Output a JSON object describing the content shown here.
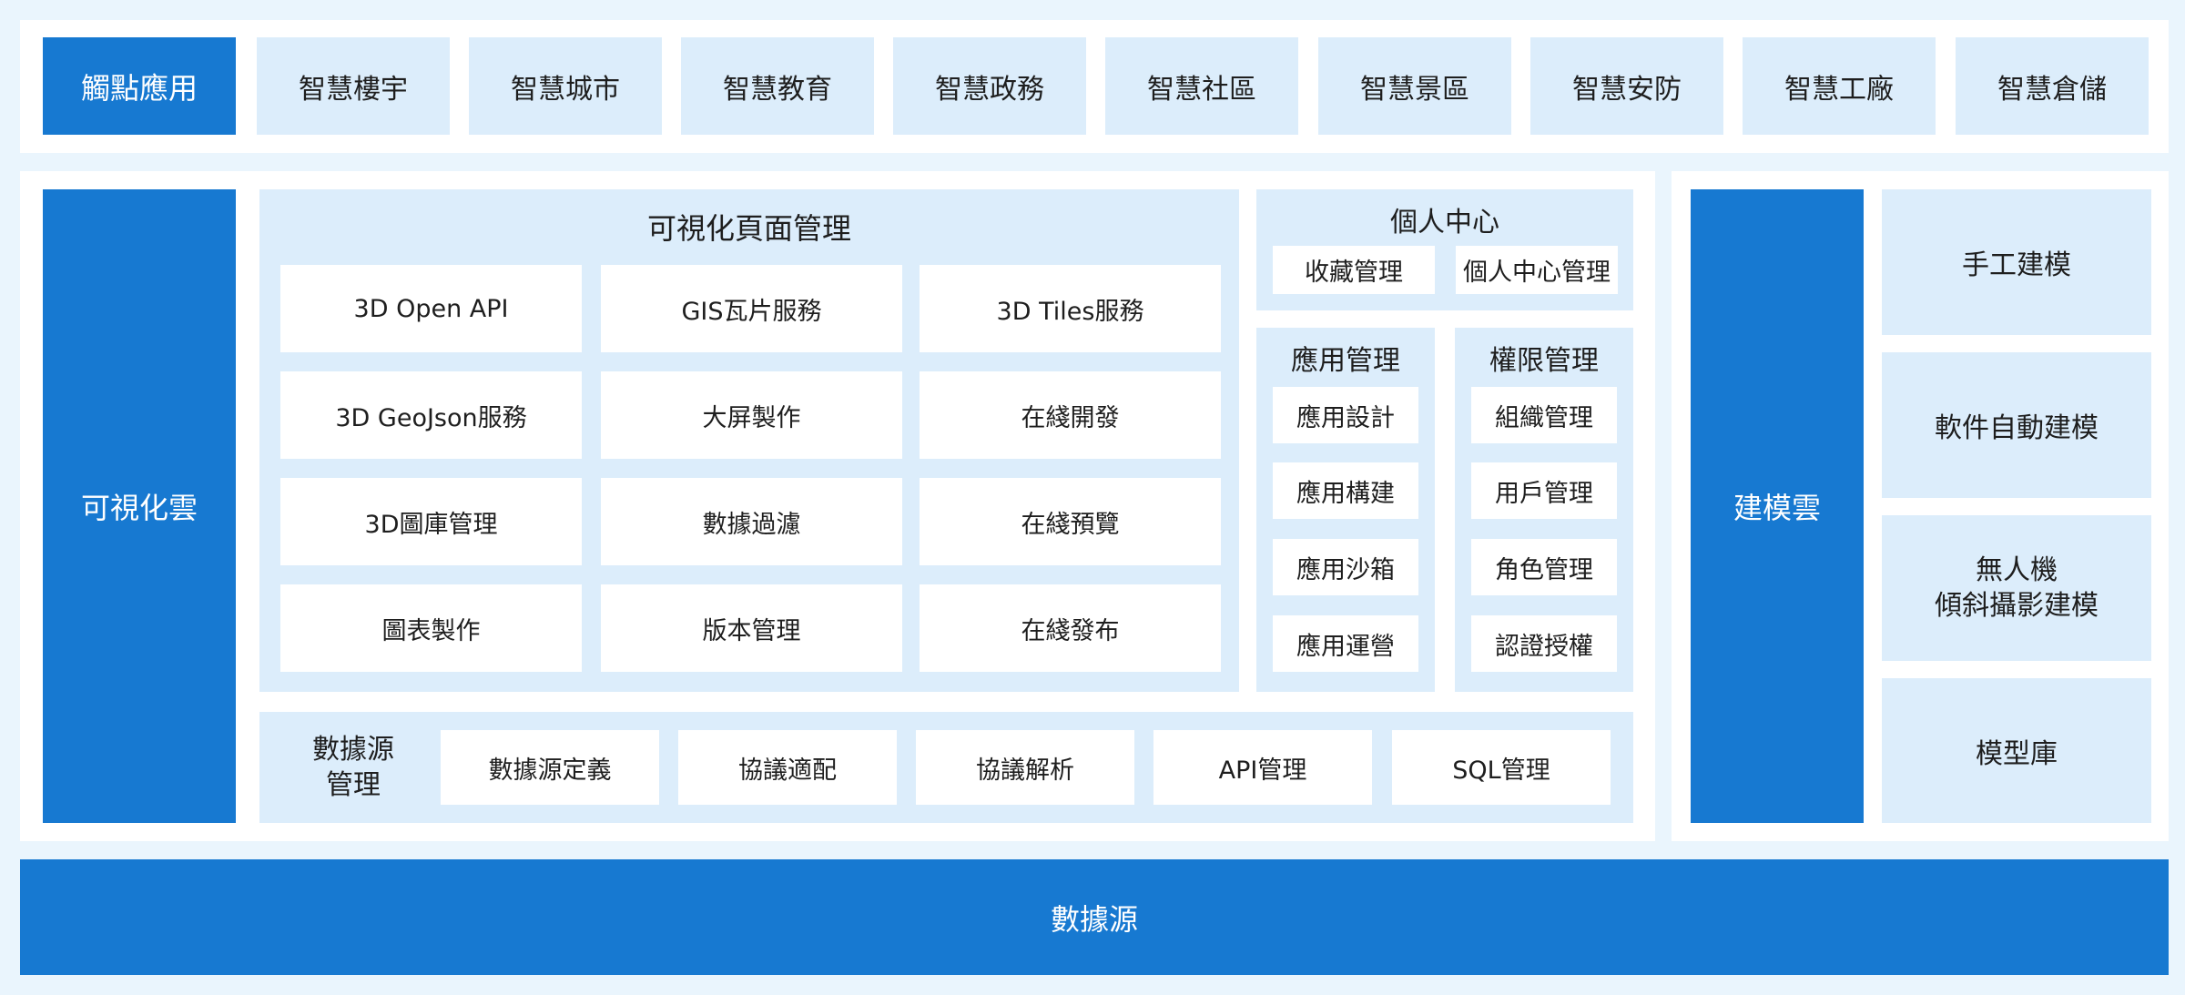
{
  "touchpoint": {
    "title": "觸點應用",
    "items": [
      "智慧樓宇",
      "智慧城市",
      "智慧教育",
      "智慧政務",
      "智慧社區",
      "智慧景區",
      "智慧安防",
      "智慧工廠",
      "智慧倉儲"
    ]
  },
  "viz_cloud": {
    "title": "可視化雲",
    "page_management": {
      "title": "可視化頁面管理",
      "items": [
        "3D Open API",
        "GIS瓦片服務",
        "3D Tiles服務",
        "3D GeoJson服務",
        "大屏製作",
        "在綫開發",
        "3D圖庫管理",
        "數據過濾",
        "在綫預覽",
        "圖表製作",
        "版本管理",
        "在綫發布"
      ]
    },
    "personal_center": {
      "title": "個人中心",
      "items": [
        "收藏管理",
        "個人中心管理"
      ]
    },
    "app_management": {
      "title": "應用管理",
      "items": [
        "應用設計",
        "應用構建",
        "應用沙箱",
        "應用運營"
      ]
    },
    "permission_management": {
      "title": "權限管理",
      "items": [
        "組織管理",
        "用戶管理",
        "角色管理",
        "認證授權"
      ]
    },
    "datasource_management": {
      "title": "數據源\n管理",
      "items": [
        "數據源定義",
        "協議適配",
        "協議解析",
        "API管理",
        "SQL管理"
      ]
    }
  },
  "modeling_cloud": {
    "title": "建模雲",
    "items": [
      "手工建模",
      "軟件自動建模",
      "無人機\n傾斜攝影建模",
      "模型庫"
    ]
  },
  "datasource": {
    "title": "數據源"
  }
}
